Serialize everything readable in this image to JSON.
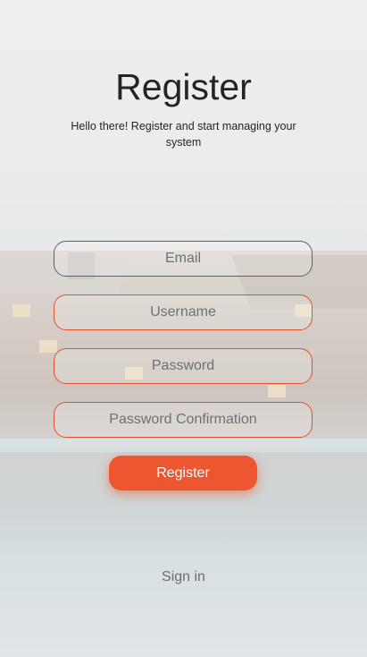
{
  "header": {
    "title": "Register",
    "subtitle": "Hello there! Register and start managing your system"
  },
  "form": {
    "email": {
      "placeholder": "Email",
      "value": ""
    },
    "username": {
      "placeholder": "Username",
      "value": ""
    },
    "password": {
      "placeholder": "Password",
      "value": ""
    },
    "password_confirmation": {
      "placeholder": "Password Confirmation",
      "value": ""
    },
    "submit_label": "Register"
  },
  "footer": {
    "signin_label": "Sign in"
  },
  "colors": {
    "accent": "#ed5630",
    "error_border": "#e0522e",
    "text_dark": "#222426",
    "text_muted": "#6a6d70"
  },
  "background": {
    "description_icon": "resort-lodge-pool-photo"
  }
}
